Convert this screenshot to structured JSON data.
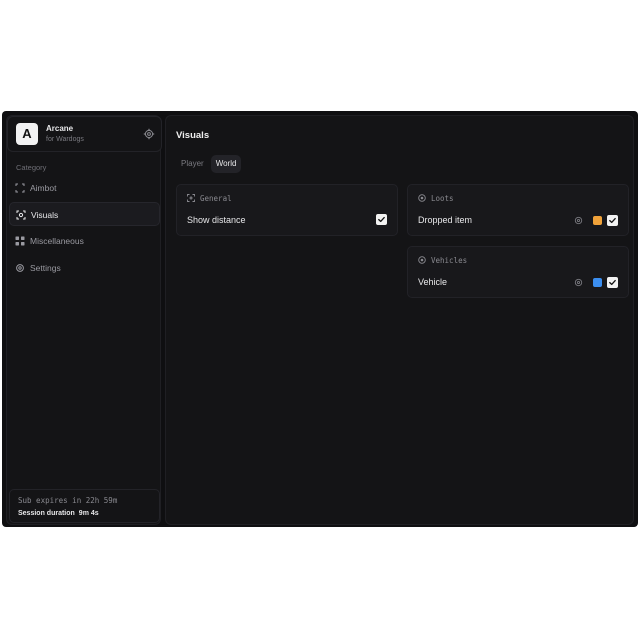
{
  "app": {
    "logo_letter": "A",
    "name": "Arcane",
    "subtitle": "for Wardogs"
  },
  "sidebar": {
    "category_label": "Category",
    "items": [
      {
        "label": "Aimbot",
        "icon": "crosshair-icon",
        "active": false
      },
      {
        "label": "Visuals",
        "icon": "eye-scan-icon",
        "active": true
      },
      {
        "label": "Miscellaneous",
        "icon": "grid-icon",
        "active": false
      },
      {
        "label": "Settings",
        "icon": "gear-icon",
        "active": false
      }
    ],
    "footer": {
      "sub_expires": "Sub expires in 22h 59m",
      "session_label": "Session duration",
      "session_value": "9m 4s"
    }
  },
  "main": {
    "title": "Visuals",
    "tabs": [
      {
        "label": "Player",
        "active": false
      },
      {
        "label": "World",
        "active": true
      }
    ],
    "cards": {
      "general": {
        "title": "General",
        "icon": "crosshair-icon",
        "row_label": "Show distance",
        "checked": true
      },
      "loots": {
        "title": "Loots",
        "icon": "target-icon",
        "row_label": "Dropped item",
        "color": "#f0a23a",
        "checked": true
      },
      "vehicles": {
        "title": "Vehicles",
        "icon": "target-icon",
        "row_label": "Vehicle",
        "color": "#3b8ef0",
        "checked": true
      }
    }
  }
}
